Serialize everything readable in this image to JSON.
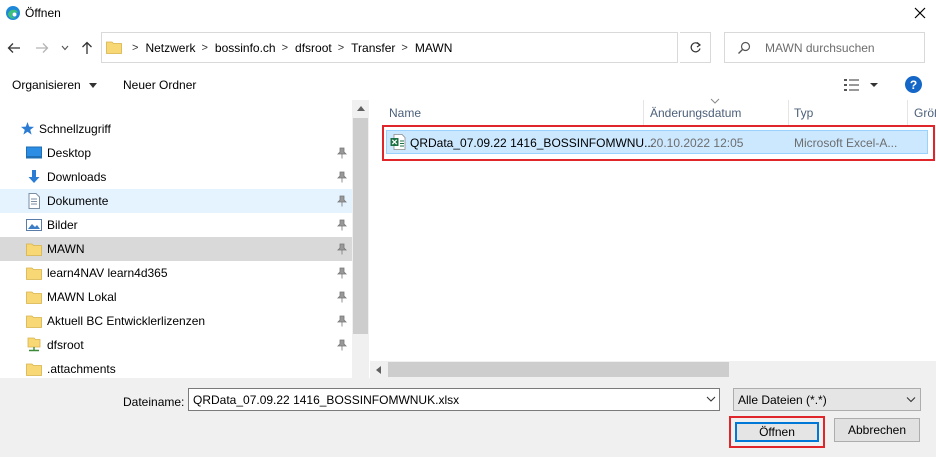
{
  "window": {
    "title": "Öffnen",
    "app_icon": "edge-icon",
    "close_icon": "close-icon"
  },
  "nav": {
    "back_icon": "back-arrow-icon",
    "forward_icon": "forward-arrow-icon",
    "recent_icon": "chevron-down-icon",
    "up_icon": "up-arrow-icon",
    "breadcrumb": [
      "Netzwerk",
      "bossinfo.ch",
      "dfsroot",
      "Transfer",
      "MAWN"
    ],
    "separator": ">",
    "refresh_icon": "refresh-icon",
    "search_placeholder": "MAWN durchsuchen"
  },
  "toolbar": {
    "organize_label": "Organisieren",
    "new_folder_label": "Neuer Ordner",
    "view_icon": "view-details-icon",
    "help_label": "?"
  },
  "sidebar": {
    "quick_access_label": "Schnellzugriff",
    "items": [
      {
        "label": "Desktop",
        "icon": "desktop-icon",
        "pinned": true
      },
      {
        "label": "Downloads",
        "icon": "download-icon",
        "pinned": true
      },
      {
        "label": "Dokumente",
        "icon": "document-icon",
        "pinned": true
      },
      {
        "label": "Bilder",
        "icon": "pictures-icon",
        "pinned": true
      },
      {
        "label": "MAWN",
        "icon": "folder-icon",
        "pinned": true
      },
      {
        "label": "learn4NAV learn4d365",
        "icon": "folder-icon",
        "pinned": true
      },
      {
        "label": "MAWN Lokal",
        "icon": "folder-icon",
        "pinned": true
      },
      {
        "label": "Aktuell BC Entwicklerlizenzen",
        "icon": "folder-icon",
        "pinned": true
      },
      {
        "label": "dfsroot",
        "icon": "network-folder-icon",
        "pinned": true
      },
      {
        "label": ".attachments",
        "icon": "folder-icon",
        "pinned": false
      }
    ]
  },
  "file_list": {
    "columns": [
      "Name",
      "Änderungsdatum",
      "Typ",
      "Größ"
    ],
    "rows": [
      {
        "name": "QRData_07.09.22 1416_BOSSINFOMWNU...",
        "modified": "20.10.2022 12:05",
        "type": "Microsoft Excel-A...",
        "icon": "excel-file-icon"
      }
    ]
  },
  "bottom": {
    "filename_label": "Dateiname:",
    "filename_value": "QRData_07.09.22 1416_BOSSINFOMWNUK.xlsx",
    "filter_value": "Alle Dateien (*.*)",
    "open_label": "Öffnen",
    "cancel_label": "Abbrechen"
  },
  "colors": {
    "accent": "#0078d7",
    "highlight": "#e0262b",
    "selection": "#cce8ff",
    "help": "#1467c6"
  }
}
